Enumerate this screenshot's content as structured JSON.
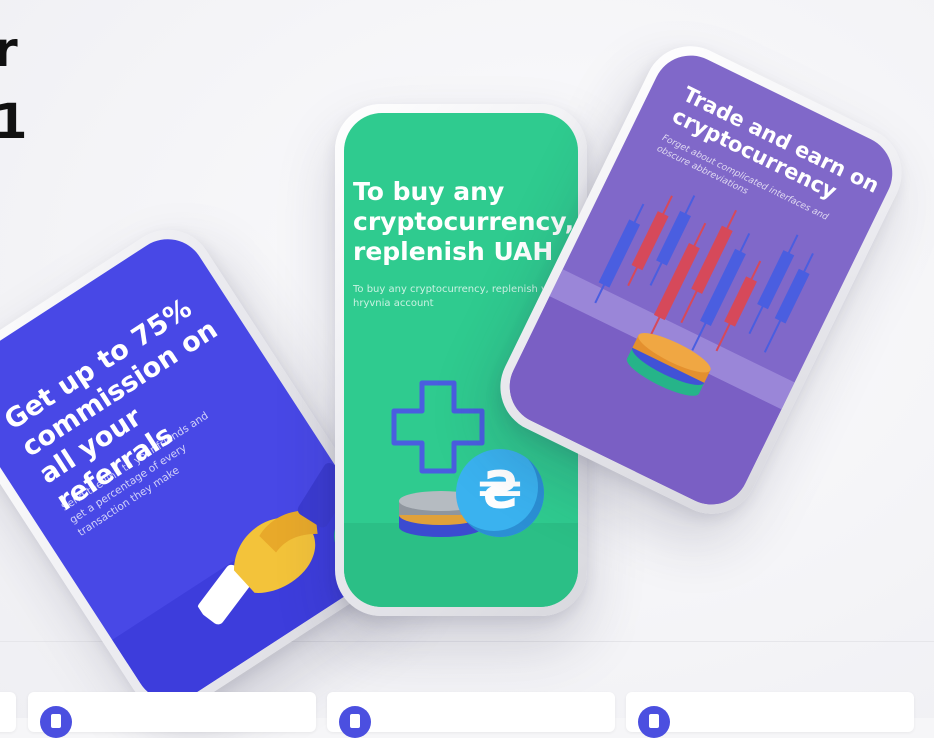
{
  "page": {
    "headline_lines": [
      "r",
      "1"
    ]
  },
  "phones": {
    "left": {
      "title": "Get up to 75% commission on all your referrals",
      "subtitle": "Send the link to your friends and get a percentage of every transaction they make",
      "color": "#4848e6"
    },
    "middle": {
      "title": "To buy any cryptocurrency, replenish UAH",
      "subtitle": "To buy any cryptocurrency, replenish your hryvnia account",
      "coin_symbol": "₴",
      "color": "#2fcb8f"
    },
    "right": {
      "title": "Trade and earn on cryptocurrency",
      "subtitle": "Forget about complicated interfaces and obscure abbreviations",
      "color": "#8068c9"
    }
  },
  "feature_cards": [
    {
      "icon": "phone-icon"
    },
    {
      "icon": "phone-icon"
    },
    {
      "icon": "phone-icon"
    }
  ]
}
